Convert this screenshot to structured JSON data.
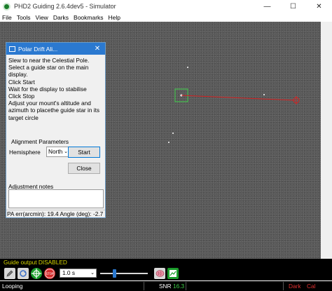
{
  "window": {
    "title": "PHD2 Guiding 2.6.4dev5 - Simulator",
    "controls": [
      "—",
      "☐",
      "✕"
    ]
  },
  "menu": [
    "File",
    "Tools",
    "View",
    "Darks",
    "Bookmarks",
    "Help"
  ],
  "dialog": {
    "title": "Polar Drift Ali...",
    "close": "✕",
    "instructions": [
      "Slew to near the Celestial Pole.",
      "Select a guide star on the main display.",
      "Click Start",
      "Wait for the display to stabilise",
      "Click Stop",
      "Adjust your mount's altitude and azimuth to placethe guide star in its target circle"
    ],
    "alignment_parameters_label": "Alignment Parameters",
    "hemisphere_label": "Hemisphere",
    "hemisphere_value": "North",
    "start_label": "Start",
    "close_label": "Close",
    "adjustment_notes_label": "Adjustment notes",
    "adjustment_notes_value": "",
    "status": "PA err(arcmin): 19.4 Angle (deg): -2.7"
  },
  "guide_output": "Guide output DISABLED",
  "toolbar": {
    "exposure_value": "1.0 s",
    "icons": [
      "pencil-icon",
      "loop-icon",
      "crosshair-icon",
      "stop-icon",
      "brain-icon",
      "chart-icon"
    ],
    "slider_level": 0.3
  },
  "statusbar": {
    "state": "Looping",
    "snr_label": "SNR",
    "snr_value": "16.3",
    "dark_label": "Dark",
    "cal_label": "Cal"
  },
  "colors": {
    "accent": "#2b79d0",
    "guide_output_text": "#d6d600",
    "selection_box": "#3fd04a",
    "drift_line": "#d62020",
    "snr_value": "#3fd04a",
    "dark_label": "#e03030",
    "cal_label": "#e03030"
  }
}
